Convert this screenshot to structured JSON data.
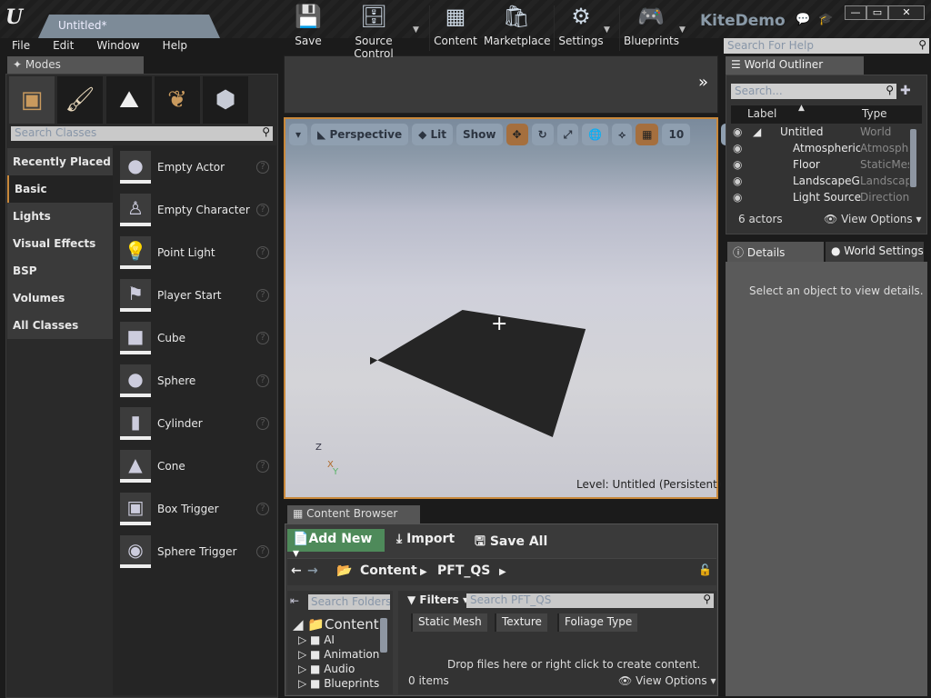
{
  "window": {
    "document_tab": "Untitled*",
    "app_title": "KiteDemo",
    "controls": {
      "minimize": "—",
      "maximize": "▭",
      "close": "✕"
    }
  },
  "menu": [
    "File",
    "Edit",
    "Window",
    "Help"
  ],
  "help_search": {
    "placeholder": "Search For Help"
  },
  "modes": {
    "tab_label": "Modes",
    "mode_icons": [
      "place-mode-icon",
      "paint-mode-icon",
      "landscape-mode-icon",
      "foliage-mode-icon",
      "geometry-mode-icon"
    ],
    "search_placeholder": "Search Classes",
    "categories": [
      "Recently Placed",
      "Basic",
      "Lights",
      "Visual Effects",
      "BSP",
      "Volumes",
      "All Classes"
    ],
    "selected_category": "Basic",
    "items": [
      {
        "label": "Empty Actor",
        "glyph": "●"
      },
      {
        "label": "Empty Character",
        "glyph": "♙"
      },
      {
        "label": "Point Light",
        "glyph": "💡"
      },
      {
        "label": "Player Start",
        "glyph": "⚑"
      },
      {
        "label": "Cube",
        "glyph": "■"
      },
      {
        "label": "Sphere",
        "glyph": "●"
      },
      {
        "label": "Cylinder",
        "glyph": "▮"
      },
      {
        "label": "Cone",
        "glyph": "▲"
      },
      {
        "label": "Box Trigger",
        "glyph": "▣"
      },
      {
        "label": "Sphere Trigger",
        "glyph": "◉"
      }
    ]
  },
  "toolbar": {
    "save": "Save",
    "source_control": "Source Control",
    "content": "Content",
    "marketplace": "Marketplace",
    "settings": "Settings",
    "blueprints": "Blueprints",
    "overflow": "»"
  },
  "viewport": {
    "view_mode": "Perspective",
    "lighting": "Lit",
    "show": "Show",
    "grid_snap_value": "10",
    "level_label": "Level:  Untitled (Persistent)",
    "axis": {
      "z": "Z",
      "x": "X",
      "y": "Y"
    }
  },
  "world_outliner": {
    "tab_label": "World Outliner",
    "search_placeholder": "Search...",
    "columns": {
      "label": "Label",
      "type": "Type"
    },
    "rows": [
      {
        "label": "Untitled",
        "type": "World"
      },
      {
        "label": "Atmospheric Fog",
        "type": "AtmosphericFog"
      },
      {
        "label": "Floor",
        "type": "StaticMeshActor"
      },
      {
        "label": "LandscapeGizmo",
        "type": "LandscapeGizmo"
      },
      {
        "label": "Light Source",
        "type": "DirectionalLight"
      }
    ],
    "actor_count": "6 actors",
    "view_options": "View Options"
  },
  "details": {
    "tab_label": "Details",
    "world_settings_tab": "World Settings",
    "empty_message": "Select an object to view details."
  },
  "content_browser": {
    "tab_label": "Content Browser",
    "add_new": "Add New",
    "import": "Import",
    "save_all": "Save All",
    "path": [
      "Content",
      "PFT_QS"
    ],
    "folder_search_placeholder": "Search Folders",
    "tree": {
      "root": "Content",
      "children": [
        "AI",
        "Animation",
        "Audio",
        "Blueprints"
      ]
    },
    "filters_label": "Filters",
    "asset_search_placeholder": "Search PFT_QS",
    "filter_chips": [
      "Static Mesh",
      "Texture",
      "Foliage Type"
    ],
    "empty_message": "Drop files here or right click to create content.",
    "item_count": "0 items",
    "view_options": "View Options"
  }
}
